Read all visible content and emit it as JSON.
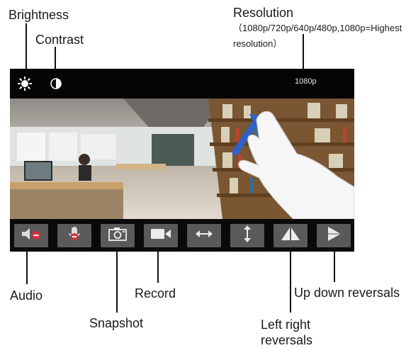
{
  "labels": {
    "brightness": "Brightness",
    "contrast": "Contrast",
    "resolution_title": "Resolution",
    "resolution_detail": "（1080p/720p/640p/480p,1080p=Highest resolution）",
    "audio": "Audio",
    "snapshot": "Snapshot",
    "record": "Record",
    "left_right_1": "Left right",
    "left_right_2": "reversals",
    "up_down": "Up down reversals"
  },
  "topbar": {
    "brightness_icon": "sun-icon",
    "contrast_icon": "half-circle-icon",
    "resolution_value": "1080p"
  },
  "controls": [
    {
      "name": "audio",
      "icon": "speaker-muted-icon"
    },
    {
      "name": "microphone",
      "icon": "microphone-icon"
    },
    {
      "name": "snapshot",
      "icon": "camera-icon"
    },
    {
      "name": "record",
      "icon": "video-camera-icon"
    },
    {
      "name": "horizontal-flip",
      "icon": "left-right-arrow-icon"
    },
    {
      "name": "vertical-flip",
      "icon": "up-down-arrow-icon"
    },
    {
      "name": "left-right-reversal",
      "icon": "mirror-triangles-icon"
    },
    {
      "name": "up-down-reversal",
      "icon": "play-triangle-icon"
    }
  ],
  "colors": {
    "bar": "#050505",
    "button": "#5a5a5a",
    "mute_badge": "#d6313b",
    "swipe_arrow": "#2f62c8"
  }
}
